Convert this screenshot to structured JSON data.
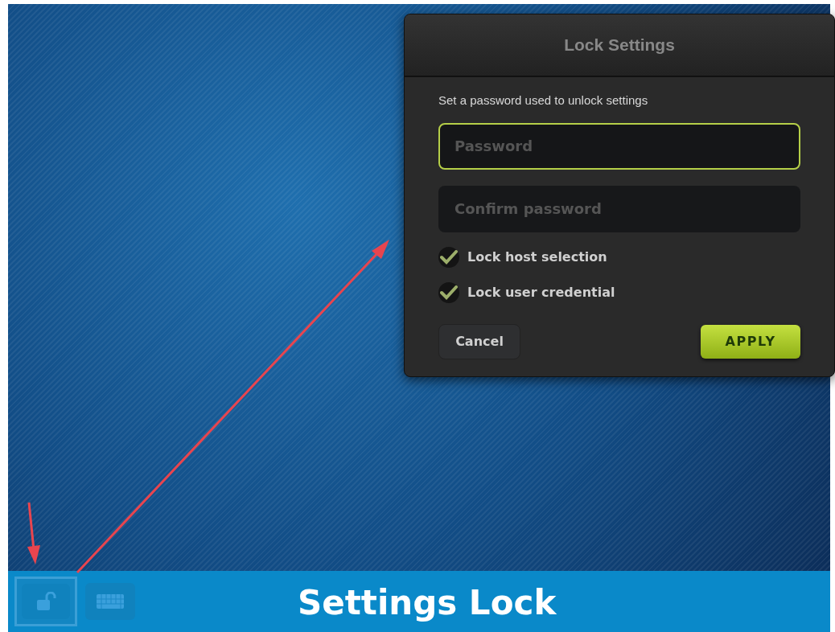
{
  "dialog": {
    "title": "Lock Settings",
    "instruction": "Set a password used to unlock settings",
    "fields": [
      {
        "placeholder": "Password",
        "focused": true
      },
      {
        "placeholder": "Confirm password",
        "focused": false
      }
    ],
    "options": [
      {
        "label": "Lock host selection",
        "checked": true
      },
      {
        "label": "Lock user credential",
        "checked": true
      }
    ],
    "buttons": [
      {
        "label": "Cancel",
        "kind": "secondary"
      },
      {
        "label": "APPLY",
        "kind": "primary"
      }
    ]
  },
  "taskbar": {
    "items": [
      {
        "kind": "lock",
        "selected": true
      },
      {
        "kind": "keyboard",
        "selected": false
      }
    ]
  },
  "caption": "Settings Lock"
}
